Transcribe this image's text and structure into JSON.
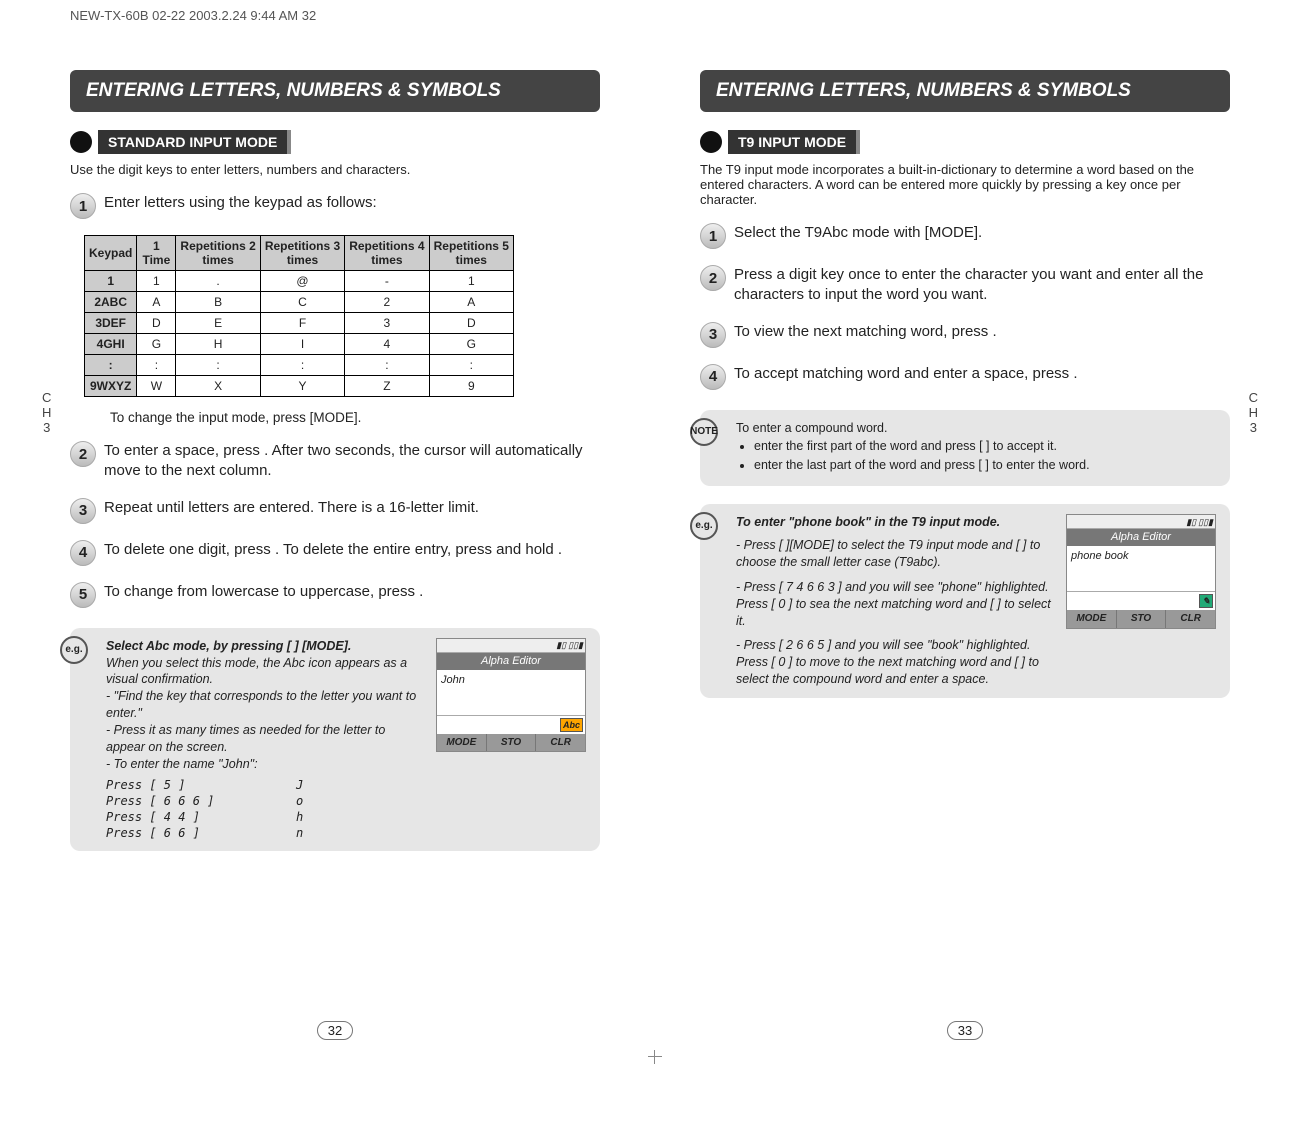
{
  "top_header": "NEW-TX-60B 02-22  2003.2.24 9:44 AM     32",
  "side_tab": {
    "line1": "C",
    "line2": "H",
    "line3": "3"
  },
  "left": {
    "banner": "ENTERING LETTERS, NUMBERS & SYMBOLS",
    "mode_title": "STANDARD INPUT MODE",
    "intro": "Use the digit keys to enter letters, numbers and characters.",
    "step1": "Enter letters using the keypad as follows:",
    "table": {
      "headers": [
        "Keypad",
        "1 Time",
        "Repetitions 2 times",
        "Repetitions 3 times",
        "Repetitions 4 times",
        "Repetitions 5 times"
      ],
      "rows": [
        [
          "1",
          "1",
          ".",
          "@",
          "-",
          "1"
        ],
        [
          "2ABC",
          "A",
          "B",
          "C",
          "2",
          "A"
        ],
        [
          "3DEF",
          "D",
          "E",
          "F",
          "3",
          "D"
        ],
        [
          "4GHI",
          "G",
          "H",
          "I",
          "4",
          "G"
        ],
        [
          ":",
          ":",
          ":",
          ":",
          ":",
          ":"
        ],
        [
          "9WXYZ",
          "W",
          "X",
          "Y",
          "Z",
          "9"
        ]
      ]
    },
    "change_mode": "To change the input mode, press          [MODE].",
    "step2": "To enter a space, press         . After two seconds, the cursor will automatically move to the next column.",
    "step3": "Repeat until letters are entered. There is a 16-letter limit.",
    "step4": "To delete one digit, press         . To delete the entire entry, press and hold         .",
    "step5": "To change from lowercase to uppercase, press          .",
    "eg": {
      "tag": "e.g.",
      "title": "Select Abc mode, by pressing [        ] [MODE].",
      "l1": "When you select this mode, the Abc icon appears as a visual confirmation.",
      "l2": "- \"Find the key that corresponds to the letter you want to enter.\"",
      "l3": "- Press it as many times as needed for the letter to appear on the screen.",
      "l4": "- To enter the name \"John\":",
      "rows": [
        {
          "label": "Press [ 5 ]",
          "ch": "J"
        },
        {
          "label": "Press [ 6  6  6 ]",
          "ch": "o"
        },
        {
          "label": "Press [ 4  4 ]",
          "ch": "h"
        },
        {
          "label": "Press [ 6  6 ]",
          "ch": "n"
        }
      ],
      "screen": {
        "title": "Alpha Editor",
        "body": "John",
        "indicator": "Abc",
        "softkeys": [
          "MODE",
          "STO",
          "CLR"
        ]
      }
    },
    "pagenum": "32"
  },
  "right": {
    "banner": "ENTERING LETTERS, NUMBERS & SYMBOLS",
    "mode_title": "T9 INPUT MODE",
    "intro": "The T9 input mode incorporates a built-in-dictionary to determine a word based on the entered characters. A word can be entered more quickly by pressing a key once per character.",
    "step1": "Select the T9Abc mode with         [MODE].",
    "step2": "Press a digit key once to enter the character you want and enter all the characters to input the word you want.",
    "step3": "To view the next matching word, press         .",
    "step4": "To accept matching word and enter a space, press         .",
    "note": {
      "tag": "NOTE",
      "title": "To enter a compound word.",
      "b1": "enter the first part of the word and press [       ] to accept it.",
      "b2": "enter the last part of the word and press [       ] to enter the word."
    },
    "eg": {
      "tag": "e.g.",
      "title": "To enter \"phone book\" in the T9 input mode.",
      "p1": "- Press [        ][MODE] to select the T9 input mode and [        ] to choose the small letter case (T9abc).",
      "p2": "- Press [ 7  4  6  6  3 ] and you will see \"phone\" highlighted. Press [ 0 ] to sea the next matching word and [   ] to select it.",
      "p3": "- Press [ 2  6  6  5 ] and you will see \"book\" highlighted. Press [ 0 ] to move to the next matching word and [       ] to select the compound word and enter a space.",
      "screen": {
        "title": "Alpha Editor",
        "body": "phone book",
        "indicator": "",
        "softkeys": [
          "MODE",
          "STO",
          "CLR"
        ]
      }
    },
    "pagenum": "33"
  }
}
